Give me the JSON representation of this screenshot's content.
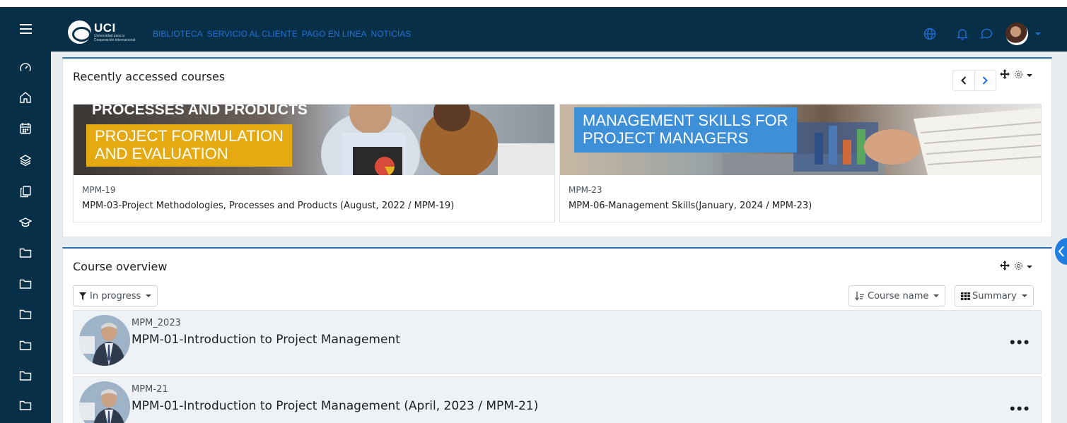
{
  "header": {
    "logo_big": "UCI",
    "logo_small_1": "Universidad para la",
    "logo_small_2": "Cooperación Internacional",
    "nav": [
      "BIBLIOTECA",
      "SERVICIO AL CLIENTE",
      "PAGO EN LINEA",
      "NOTICIAS"
    ],
    "icons": [
      "globe-icon",
      "bell-icon",
      "chat-icon",
      "user-avatar"
    ]
  },
  "sidebar": {
    "icons": [
      "dashboard-icon",
      "home-icon",
      "calendar-icon",
      "layers-icon",
      "files-icon",
      "graduation-cap-icon",
      "folder-icon",
      "folder-icon",
      "folder-icon",
      "folder-icon",
      "folder-icon",
      "folder-icon"
    ]
  },
  "recent": {
    "title": "Recently accessed courses",
    "courses": [
      {
        "banner_top": "PROCESSES AND PRODUCTS",
        "banner_line1": "PROJECT FORMULATION",
        "banner_line2": "AND EVALUATION",
        "shortname": "MPM-19",
        "fullname": "MPM-03-Project Methodologies, Processes and Products (August, 2022 / MPM-19)"
      },
      {
        "banner_line1": "MANAGEMENT SKILLS FOR",
        "banner_line2": "PROJECT MANAGERS",
        "shortname": "MPM-23",
        "fullname": "MPM-06-Management Skills(January, 2024 / MPM-23)"
      }
    ]
  },
  "overview": {
    "title": "Course overview",
    "filter_label": "In progress",
    "sort_label": "Course name",
    "view_label": "Summary",
    "items": [
      {
        "shortname": "MPM_2023",
        "fullname": "MPM-01-Introduction to Project Management",
        "menu": "•••"
      },
      {
        "shortname": "MPM-21",
        "fullname": "MPM-01-Introduction to Project Management (April, 2023 / MPM-21)",
        "menu": "•••"
      }
    ]
  },
  "colors": {
    "topbar": "#073048",
    "nav_link": "#1f6fd6",
    "accent_border": "#2e74b5",
    "banner_yellow": "#e5a912",
    "banner_blue": "#3d8fd8"
  }
}
